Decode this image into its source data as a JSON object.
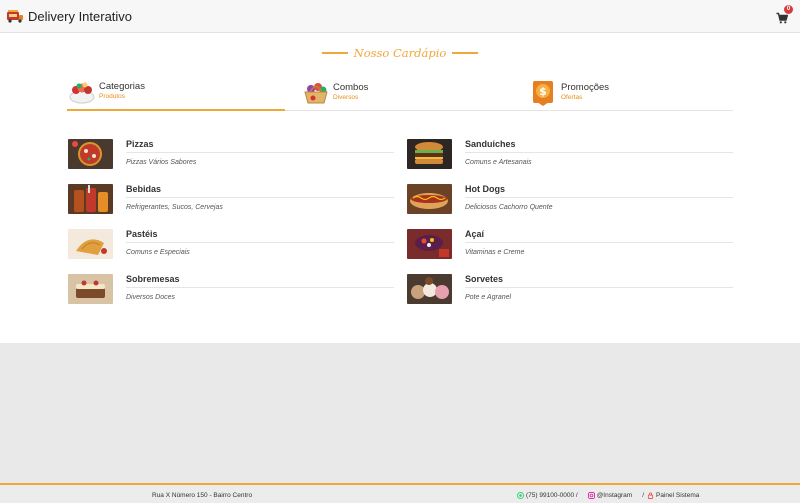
{
  "app": {
    "title": "Delivery Interativo"
  },
  "cart": {
    "count": "0"
  },
  "menu": {
    "heading": "Nosso Cardápio"
  },
  "tabs": [
    {
      "title": "Categorias",
      "subtitle": "Produtos",
      "active": true
    },
    {
      "title": "Combos",
      "subtitle": "Diversos",
      "active": false
    },
    {
      "title": "Promoções",
      "subtitle": "Ofertas",
      "active": false
    }
  ],
  "categories": [
    {
      "name": "Pizzas",
      "description": "Pizzas Vários Sabores"
    },
    {
      "name": "Sanduiches",
      "description": "Comuns e Artesanais"
    },
    {
      "name": "Bebidas",
      "description": "Refrigerantes, Sucos, Cervejas"
    },
    {
      "name": "Hot Dogs",
      "description": "Deliciosos Cachorro Quente"
    },
    {
      "name": "Pastéis",
      "description": "Comuns e Especiais"
    },
    {
      "name": "Açaí",
      "description": "Vitaminas e Creme"
    },
    {
      "name": "Sobremesas",
      "description": "Diversos Doces"
    },
    {
      "name": "Sorvetes",
      "description": "Pote e Agranel"
    }
  ],
  "footer": {
    "address": "Rua X Número 150 - Bairro Centro",
    "phone": "(75) 99100-0000 /",
    "instagram": "@Instagram",
    "separator": "/",
    "panel": "Painel Sistema"
  },
  "colors": {
    "accent": "#f0a73a",
    "badge": "#d93b3b",
    "whatsapp": "#25d366",
    "instagram": "#d6249f"
  }
}
